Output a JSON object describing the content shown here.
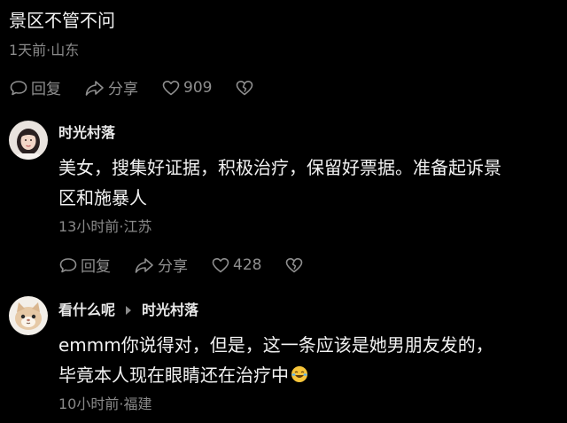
{
  "top_comment": {
    "text": "景区不管不问",
    "meta": "1天前·山东",
    "reply_label": "回复",
    "share_label": "分享",
    "like_count": "909"
  },
  "comments": [
    {
      "author": "时光村落",
      "lines": [
        "美女，搜集好证据，积极治疗，保留好票据。准备起诉景",
        "区和施暴人"
      ],
      "meta": "13小时前·江苏",
      "reply_label": "回复",
      "share_label": "分享",
      "like_count": "428"
    },
    {
      "author": "看什么呢",
      "reply_to": "时光村落",
      "lines": [
        "emmm你说得对，但是，这一条应该是她男朋友发的，",
        "毕竟本人现在眼睛还在治疗中"
      ],
      "meta": "10小时前·福建"
    }
  ],
  "icons": {
    "reply": "comment-bubble-icon",
    "share": "share-arrow-icon",
    "like": "heart-icon",
    "dislike": "broken-heart-icon",
    "emoji": "laughing-tears-emoji"
  },
  "colors": {
    "background": "#000000",
    "text": "#f2f2f2",
    "secondary": "#8a8a8a"
  }
}
